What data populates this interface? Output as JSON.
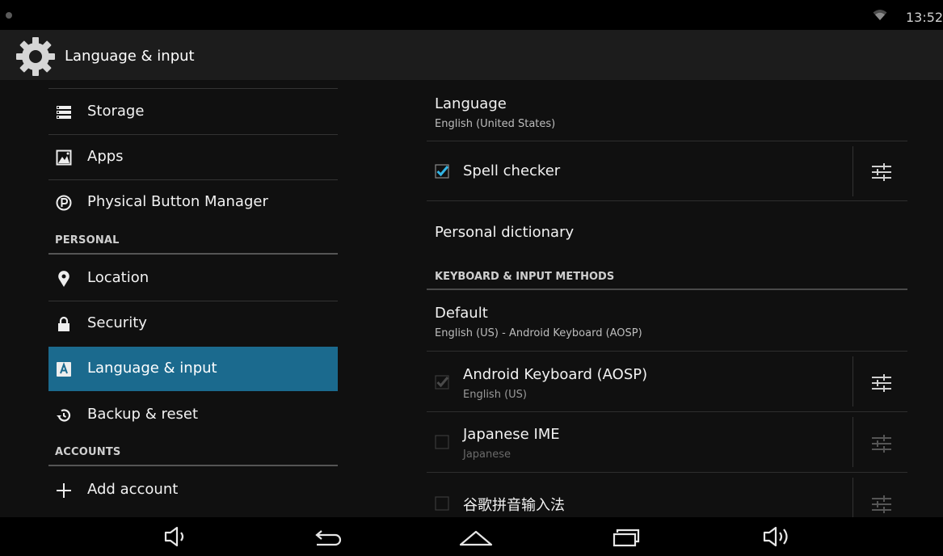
{
  "status_bar": {
    "time": "13:52"
  },
  "action_bar": {
    "title": "Language & input"
  },
  "left_nav": {
    "items": [
      {
        "label": "Storage",
        "icon": "storage-icon"
      },
      {
        "label": "Apps",
        "icon": "apps-icon"
      },
      {
        "label": "Physical Button Manager",
        "icon": "physical-button-icon"
      },
      {
        "label": "Location",
        "icon": "location-pin-icon"
      },
      {
        "label": "Security",
        "icon": "lock-icon"
      },
      {
        "label": "Language & input",
        "icon": "language-icon",
        "selected": true
      },
      {
        "label": "Backup & reset",
        "icon": "backup-icon"
      },
      {
        "label": "Add account",
        "icon": "plus-icon"
      }
    ],
    "sections": {
      "personal": "PERSONAL",
      "accounts": "ACCOUNTS"
    }
  },
  "right_pane": {
    "language": {
      "title": "Language",
      "summary": "English (United States)"
    },
    "spell_checker": {
      "title": "Spell checker",
      "checked": true
    },
    "personal_dictionary": {
      "title": "Personal dictionary"
    },
    "keyboard_header": "KEYBOARD & INPUT METHODS",
    "default": {
      "title": "Default",
      "summary": "English (US) - Android Keyboard (AOSP)"
    },
    "methods": [
      {
        "title": "Android Keyboard (AOSP)",
        "summary": "English (US)",
        "checked": true,
        "enabled": false
      },
      {
        "title": "Japanese IME",
        "summary": "Japanese",
        "checked": false,
        "enabled": false
      },
      {
        "title": "谷歌拼音输入法",
        "summary": "",
        "checked": false,
        "enabled": false
      }
    ]
  },
  "colors": {
    "accent": "#33b5e5",
    "selected_bg": "#1b6a8e",
    "background": "#101010",
    "action_bar": "#1c1c1c"
  }
}
